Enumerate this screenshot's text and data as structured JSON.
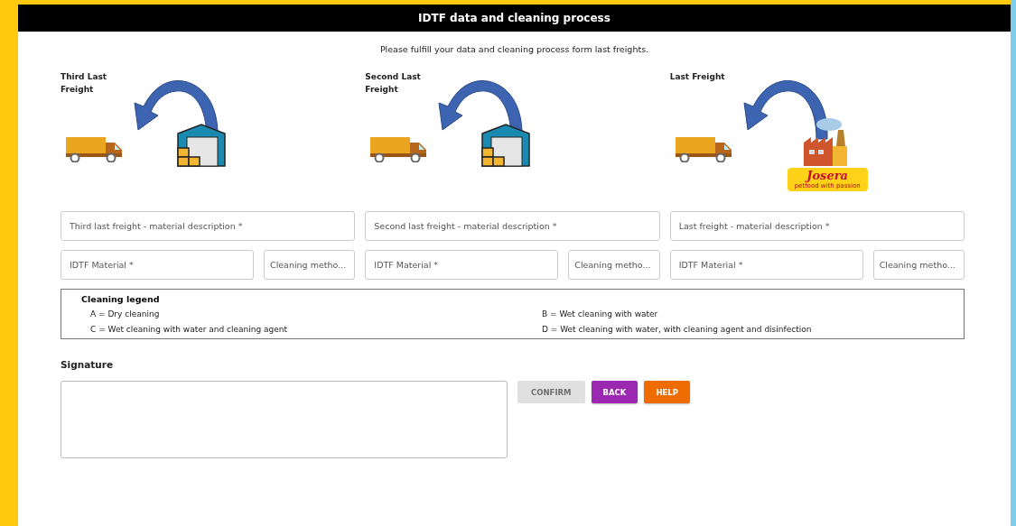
{
  "header": {
    "title": "IDTF data and cleaning process"
  },
  "intro": "Please fulfill your data and cleaning process form last freights.",
  "freights": [
    {
      "label": "Third Last Freight",
      "kind": "warehouse",
      "description_placeholder": "Third last freight - material description *",
      "material_placeholder": "IDTF Material *",
      "cleaning_placeholder": "Cleaning metho..."
    },
    {
      "label": "Second Last Freight",
      "kind": "warehouse",
      "description_placeholder": "Second last freight - material description *",
      "material_placeholder": "IDTF Material *",
      "cleaning_placeholder": "Cleaning metho..."
    },
    {
      "label": "Last Freight",
      "kind": "factory",
      "logo": {
        "name": "Josera",
        "tagline": "petfood with passion"
      },
      "description_placeholder": "Last freight - material description *",
      "material_placeholder": "IDTF Material *",
      "cleaning_placeholder": "Cleaning metho..."
    }
  ],
  "legend": {
    "title": "Cleaning legend",
    "items": [
      "A = Dry cleaning",
      "B = Wet cleaning with water",
      "C = Wet cleaning with water and cleaning agent",
      "D = Wet cleaning with water, with cleaning agent and disinfection"
    ]
  },
  "signature": {
    "label": "Signature"
  },
  "buttons": [
    {
      "label": "CONFIRM",
      "kind": "confirm",
      "disabled": true
    },
    {
      "label": "BACK",
      "kind": "back",
      "disabled": false
    },
    {
      "label": "HELP",
      "kind": "help",
      "disabled": false
    }
  ]
}
